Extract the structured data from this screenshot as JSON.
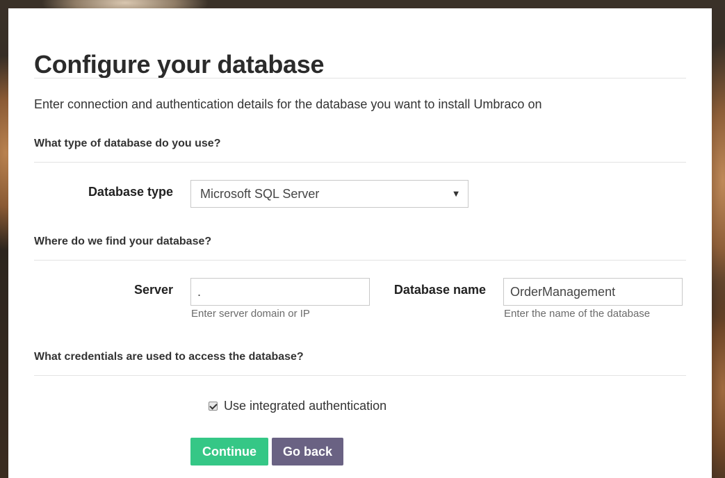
{
  "page": {
    "title": "Configure your database",
    "intro": "Enter connection and authentication details for the database you want to install Umbraco on"
  },
  "sections": {
    "type_heading": "What type of database do you use?",
    "location_heading": "Where do we find your database?",
    "credentials_heading": "What credentials are used to access the database?"
  },
  "database_type": {
    "label": "Database type",
    "selected": "Microsoft SQL Server"
  },
  "server": {
    "label": "Server",
    "value": ".",
    "help": "Enter server domain or IP"
  },
  "database_name": {
    "label": "Database name",
    "value": "OrderManagement",
    "help": "Enter the name of the database"
  },
  "auth": {
    "integrated_label": "Use integrated authentication",
    "integrated_checked": true
  },
  "actions": {
    "continue_label": "Continue",
    "back_label": "Go back"
  },
  "colors": {
    "continue": "#35c786",
    "back": "#6a6283"
  }
}
